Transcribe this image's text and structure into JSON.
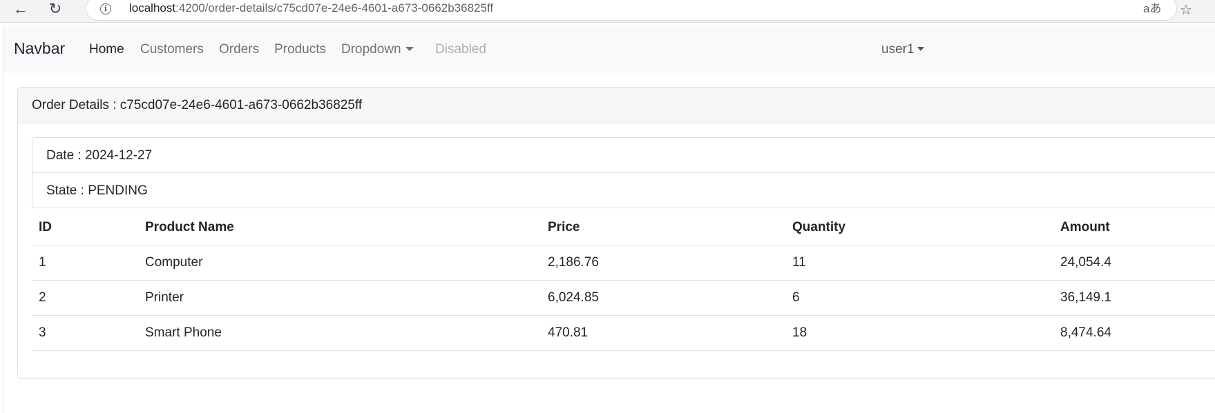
{
  "browser": {
    "url_host": "localhost",
    "url_path": ":4200/order-details/c75cd07e-24e6-4601-a673-0662b36825ff",
    "back_icon": "←",
    "reload_icon": "↻",
    "info_icon": "i",
    "translate_icon": "aあ",
    "star_icon": "☆"
  },
  "navbar": {
    "brand": "Navbar",
    "links": [
      {
        "label": "Home"
      },
      {
        "label": "Customers"
      },
      {
        "label": "Orders"
      },
      {
        "label": "Products"
      },
      {
        "label": "Dropdown"
      },
      {
        "label": "Disabled"
      }
    ],
    "user": "user1"
  },
  "card": {
    "title": "Order Details : c75cd07e-24e6-4601-a673-0662b36825ff",
    "date": "Date : 2024-12-27",
    "state": "State : PENDING"
  },
  "table": {
    "headers": [
      "ID",
      "Product Name",
      "Price",
      "Quantity",
      "Amount"
    ],
    "rows": [
      [
        "1",
        "Computer",
        "2,186.76",
        "11",
        "24,054.4"
      ],
      [
        "2",
        "Printer",
        "6,024.85",
        "6",
        "36,149.1"
      ],
      [
        "3",
        "Smart Phone",
        "470.81",
        "18",
        "8,474.64"
      ]
    ]
  },
  "colors": {
    "navbar_bg": "#f8f9fa",
    "card_header_bg": "#f7f7f7",
    "border": "#dee2e6"
  }
}
